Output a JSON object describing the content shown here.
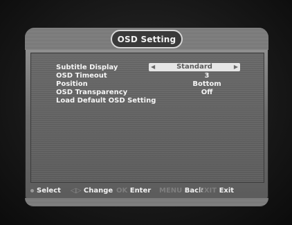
{
  "menu": {
    "title": "OSD Setting"
  },
  "settings": [
    {
      "label": "Subtitle Display",
      "value": "Standard"
    },
    {
      "label": "OSD Timeout",
      "value": "3"
    },
    {
      "label": "Position",
      "value": "Bottom"
    },
    {
      "label": "OSD Transparency",
      "value": "Off"
    },
    {
      "label": "Load Default OSD Setting",
      "value": ""
    }
  ],
  "footer": {
    "select_label": "Select",
    "change_key": "◁▷",
    "change_label": "Change",
    "ok_key": "OK",
    "enter_label": "Enter",
    "menu_key": "MENU",
    "back_label": "Back",
    "exit_key": "EXIT",
    "exit_label": "Exit"
  }
}
